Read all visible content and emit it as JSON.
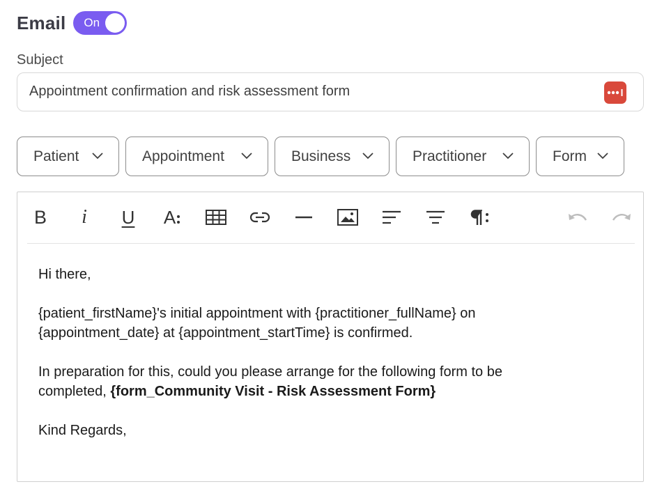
{
  "email": {
    "title": "Email",
    "toggle_label": "On",
    "toggle_state": true,
    "accent_color": "#7a5cf0"
  },
  "subject": {
    "label": "Subject",
    "value": "Appointment confirmation and risk assessment form",
    "action_icon": "more-dots-icon",
    "action_color": "#d9493b"
  },
  "merge_fields": [
    {
      "label": "Patient"
    },
    {
      "label": "Appointment"
    },
    {
      "label": "Business"
    },
    {
      "label": "Practitioner"
    },
    {
      "label": "Form"
    }
  ],
  "toolbar": {
    "bold": "B",
    "italic": "i",
    "underline": "U",
    "font_size": "A",
    "items": [
      "bold-icon",
      "italic-icon",
      "underline-icon",
      "font-size-icon",
      "table-icon",
      "link-icon",
      "horizontal-rule-icon",
      "image-icon",
      "align-left-icon",
      "align-center-icon",
      "paragraph-icon",
      "undo-icon",
      "redo-icon"
    ]
  },
  "body": {
    "greeting": "Hi there,",
    "line1_part1": "{patient_firstName}'s initial appointment with {practitioner_fullName} on",
    "line1_part2": "{appointment_date} at {appointment_startTime} is confirmed.",
    "line2_part1": "In preparation for this, could you please arrange for the following form to be",
    "line2_part2": "completed, ",
    "form_tag": "{form_Community Visit - Risk Assessment Form}",
    "closing": "Kind Regards,"
  }
}
